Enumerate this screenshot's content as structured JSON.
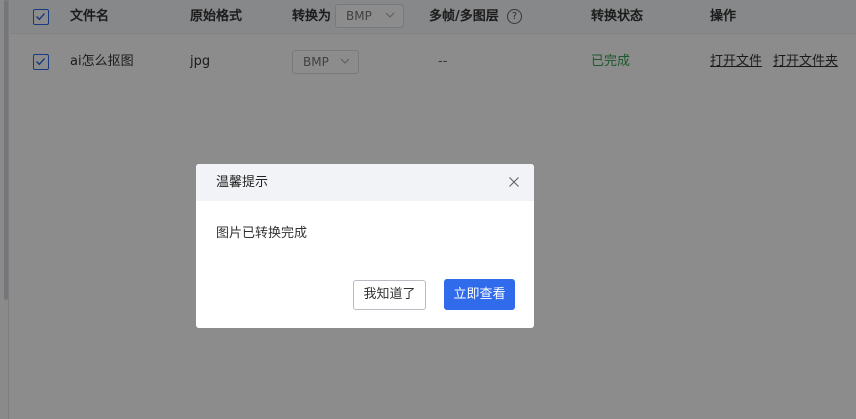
{
  "table": {
    "header": {
      "filename": "文件名",
      "original_format": "原始格式",
      "convert_to": "转换为",
      "convert_to_value": "BMP",
      "multiframe": "多帧/多图层",
      "help_glyph": "?",
      "status": "转换状态",
      "actions": "操作"
    },
    "rows": [
      {
        "filename": "ai怎么抠图",
        "original_format": "jpg",
        "target_format": "BMP",
        "multiframe": "--",
        "status": "已完成",
        "open_file": "打开文件",
        "open_folder": "打开文件夹"
      }
    ]
  },
  "dialog": {
    "title": "温馨提示",
    "message": "图片已转换完成",
    "secondary_button": "我知道了",
    "primary_button": "立即查看"
  },
  "colors": {
    "accent": "#2f6bea",
    "status_done": "#37a052",
    "overlay": "rgba(0,0,0,0.45)"
  }
}
